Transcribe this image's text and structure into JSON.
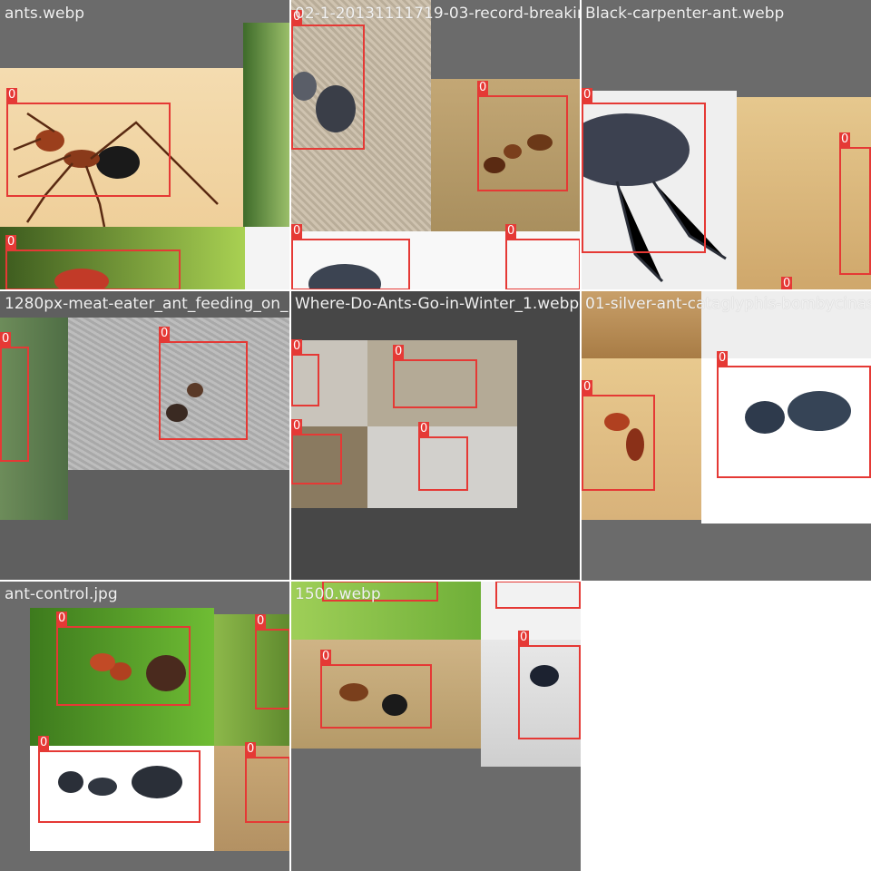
{
  "colors": {
    "tile_bg": "#666666",
    "box": "#e53935",
    "label_text": "#f2f2f2"
  },
  "mosaics": [
    {
      "filename": "ants.webp",
      "boxes": [
        "0",
        "0"
      ]
    },
    {
      "filename": "02-1-20131111719-03-record-breaking-ants.jpg",
      "boxes": [
        "0",
        "0",
        "0",
        "0"
      ]
    },
    {
      "filename": "Black-carpenter-ant.webp",
      "boxes": [
        "0",
        "0",
        "0"
      ]
    },
    {
      "filename": "1280px-meat-eater_ant_feeding_on_honey02",
      "boxes": [
        "0",
        "0"
      ]
    },
    {
      "filename": "Where-Do-Ants-Go-in-Winter_1.webp",
      "boxes": [
        "0",
        "0",
        "0",
        "0"
      ]
    },
    {
      "filename": "01-silver-ant-cataglyphis-bombycinas",
      "boxes": [
        "0",
        "0"
      ]
    },
    {
      "filename": "ant-control.jpg",
      "boxes": [
        "0",
        "0",
        "0",
        "0"
      ]
    },
    {
      "filename": "1500.webp",
      "boxes": [
        "0",
        "0",
        "0",
        "0"
      ]
    }
  ]
}
